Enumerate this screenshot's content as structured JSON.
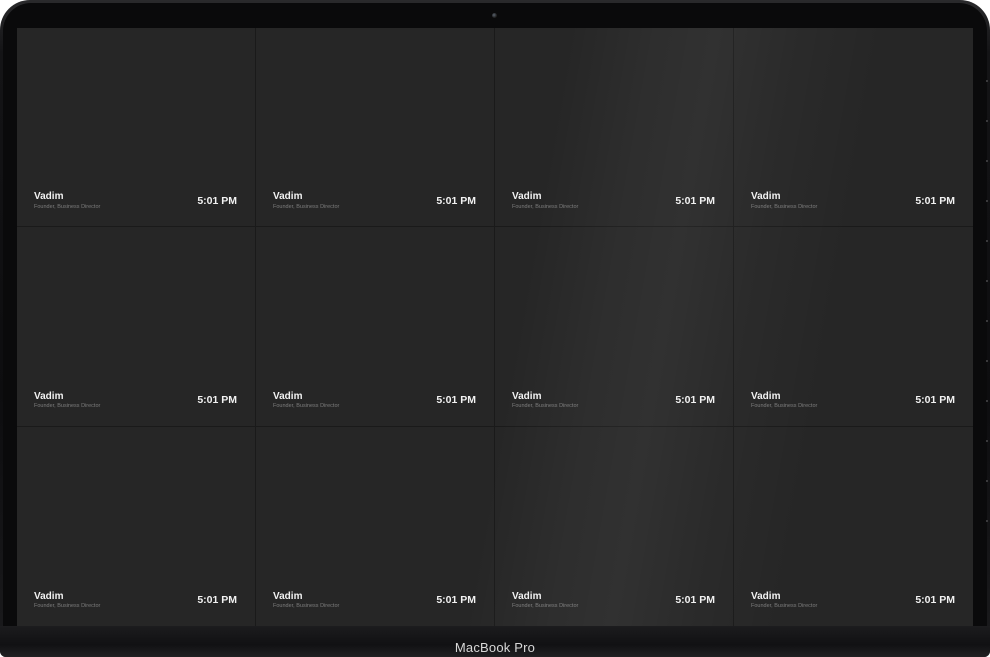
{
  "device": {
    "brand_label": "MacBook Pro"
  },
  "grid": {
    "tiles": [
      {
        "name": "Vadim",
        "role": "Founder, Business Director",
        "time": "5:01 PM"
      },
      {
        "name": "Vadim",
        "role": "Founder, Business Director",
        "time": "5:01 PM"
      },
      {
        "name": "Vadim",
        "role": "Founder, Business Director",
        "time": "5:01 PM"
      },
      {
        "name": "Vadim",
        "role": "Founder, Business Director",
        "time": "5:01 PM"
      },
      {
        "name": "Vadim",
        "role": "Founder, Business Director",
        "time": "5:01 PM"
      },
      {
        "name": "Vadim",
        "role": "Founder, Business Director",
        "time": "5:01 PM"
      },
      {
        "name": "Vadim",
        "role": "Founder, Business Director",
        "time": "5:01 PM"
      },
      {
        "name": "Vadim",
        "role": "Founder, Business Director",
        "time": "5:01 PM"
      },
      {
        "name": "Vadim",
        "role": "Founder, Business Director",
        "time": "5:01 PM"
      },
      {
        "name": "Vadim",
        "role": "Founder, Business Director",
        "time": "5:01 PM"
      },
      {
        "name": "Vadim",
        "role": "Founder, Business Director",
        "time": "5:01 PM"
      },
      {
        "name": "Vadim",
        "role": "Founder, Business Director",
        "time": "5:01 PM"
      }
    ]
  },
  "colors": {
    "tile_background": "#262626",
    "divider": "#1a1a1a",
    "primary_text": "#f2f2f2",
    "secondary_text": "#7d7d7d"
  }
}
